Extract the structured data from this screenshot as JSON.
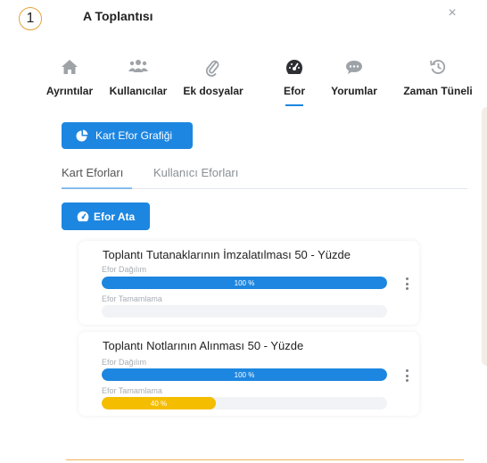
{
  "step_number": "1",
  "modal": {
    "title": "A Toplantısı",
    "close_glyph": "×"
  },
  "tabs": [
    {
      "label": "Ayrıntılar",
      "icon": "home-icon"
    },
    {
      "label": "Kullanıcılar",
      "icon": "users-icon"
    },
    {
      "label": "Ek dosyalar",
      "icon": "paperclip-icon"
    },
    {
      "label": "Efor",
      "icon": "gauge-icon",
      "active": true
    },
    {
      "label": "Yorumlar",
      "icon": "chat-bubble-icon"
    },
    {
      "label": "Zaman Tüneli",
      "icon": "history-icon"
    }
  ],
  "chart_button": {
    "label": "Kart Efor Grafiği",
    "icon": "pie-chart-icon"
  },
  "subtabs": [
    {
      "label": "Kart Eforları",
      "active": true
    },
    {
      "label": "Kullanıcı Eforları",
      "active": false
    }
  ],
  "assign_button": {
    "label": "Efor Ata",
    "icon": "gauge-icon"
  },
  "cards": [
    {
      "title": "Toplantı Tutanaklarının İmzalatılması 50 - Yüzde",
      "distribution_label": "Efor Dağılım",
      "distribution_value": 100,
      "distribution_text": "100 %",
      "completion_label": "Efor Tamamlama",
      "completion_value": 0,
      "completion_text": ""
    },
    {
      "title": "Toplantı Notlarının Alınması 50 - Yüzde",
      "distribution_label": "Efor Dağılım",
      "distribution_value": 100,
      "distribution_text": "100 %",
      "completion_label": "Efor Tamamlama",
      "completion_value": 40,
      "completion_text": "40 %"
    }
  ],
  "colors": {
    "accent": "#1d86e0",
    "completion": "#f5bd00",
    "badge_border": "#e3a33b"
  }
}
